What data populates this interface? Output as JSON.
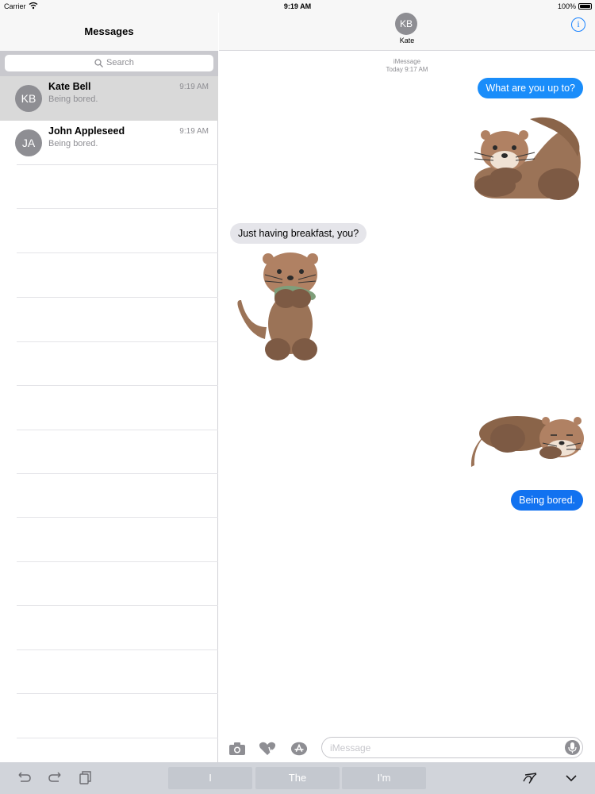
{
  "status_bar": {
    "carrier": "Carrier",
    "time": "9:19 AM",
    "battery": "100%"
  },
  "sidebar": {
    "title": "Messages",
    "search_placeholder": "Search",
    "conversations": [
      {
        "initials": "KB",
        "name": "Kate Bell",
        "preview": "Being bored.",
        "time": "9:19 AM",
        "selected": true
      },
      {
        "initials": "JA",
        "name": "John Appleseed",
        "preview": "Being bored.",
        "time": "9:19 AM",
        "selected": false
      }
    ]
  },
  "conversation": {
    "contact_initials": "KB",
    "contact_name": "Kate",
    "info_icon": "info-icon",
    "service_label": "iMessage",
    "timestamp": "Today 9:17 AM",
    "messages": [
      {
        "direction": "sent",
        "type": "text",
        "text": "What are you up to?"
      },
      {
        "direction": "sent",
        "type": "sticker",
        "sticker": "otter-lying-sticker"
      },
      {
        "direction": "received",
        "type": "text",
        "text": "Just having breakfast, you?"
      },
      {
        "direction": "received",
        "type": "sticker",
        "sticker": "otter-eating-fish-sticker"
      },
      {
        "direction": "sent",
        "type": "sticker",
        "sticker": "otter-sleeping-sticker"
      },
      {
        "direction": "sent",
        "type": "text",
        "text": "Being bored."
      }
    ]
  },
  "compose": {
    "placeholder": "iMessage",
    "icons": [
      "camera-icon",
      "digital-touch-icon",
      "app-store-icon",
      "microphone-icon"
    ]
  },
  "keyboard_bar": {
    "tools": [
      "undo-icon",
      "redo-icon",
      "paste-icon",
      "handwriting-icon",
      "dismiss-keyboard-icon"
    ],
    "suggestions": [
      "I",
      "The",
      "I'm"
    ]
  }
}
